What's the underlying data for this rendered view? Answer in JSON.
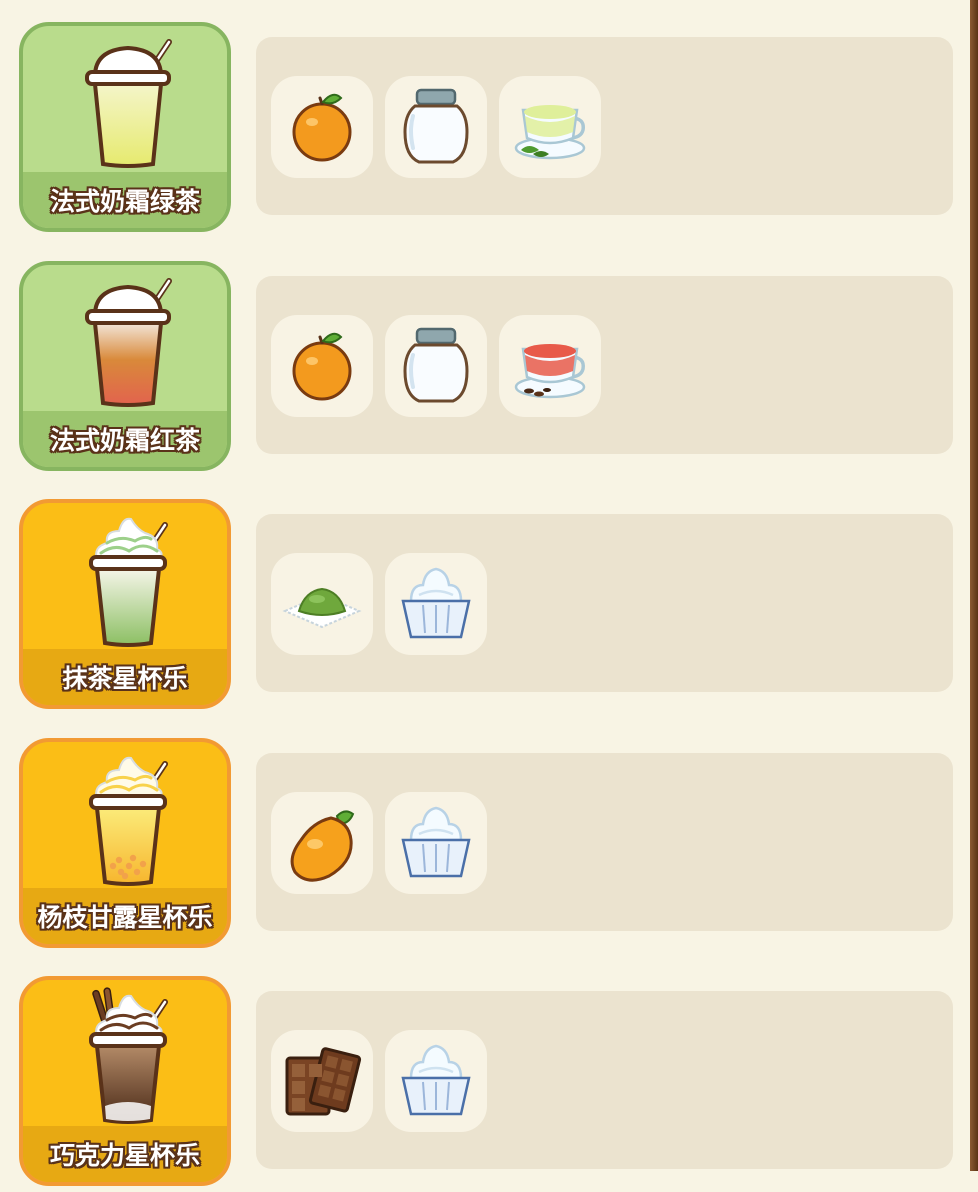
{
  "recipes": [
    {
      "name": "法式奶霜绿茶",
      "style": "green",
      "drink_icon": "green-tea-cream-drink-icon",
      "ingredients": [
        "orange-icon",
        "milk-jar-icon",
        "green-tea-cup-icon"
      ]
    },
    {
      "name": "法式奶霜红茶",
      "style": "green",
      "drink_icon": "black-tea-cream-drink-icon",
      "ingredients": [
        "orange-icon",
        "milk-jar-icon",
        "black-tea-cup-icon"
      ]
    },
    {
      "name": "抹茶星杯乐",
      "style": "orange",
      "drink_icon": "matcha-frappe-icon",
      "ingredients": [
        "matcha-powder-icon",
        "ice-cream-cup-icon"
      ]
    },
    {
      "name": "杨枝甘露星杯乐",
      "style": "orange",
      "drink_icon": "mango-frappe-icon",
      "ingredients": [
        "mango-icon",
        "ice-cream-cup-icon"
      ]
    },
    {
      "name": "巧克力星杯乐",
      "style": "orange",
      "drink_icon": "chocolate-frappe-icon",
      "ingredients": [
        "chocolate-bar-icon",
        "ice-cream-cup-icon"
      ]
    }
  ],
  "colors": {
    "background": "#f8f4e4",
    "green_card": "#b9dc8c",
    "orange_card": "#fbbe16",
    "ingredient_panel": "#ebe3cf",
    "text_outline": "#5a3219"
  }
}
